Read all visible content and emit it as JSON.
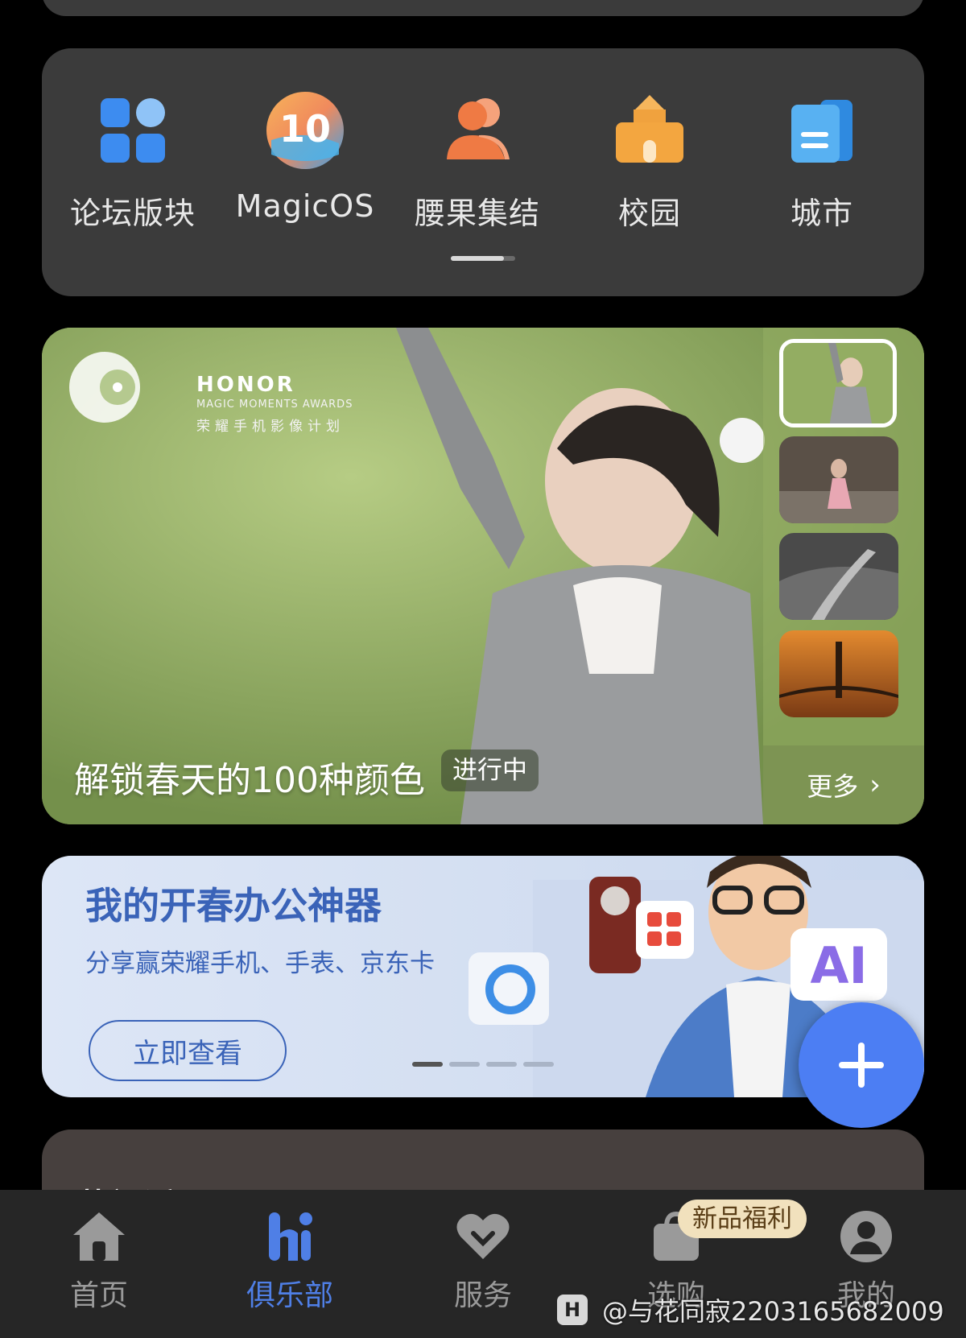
{
  "quick_nav": {
    "items": [
      {
        "label": "论坛版块",
        "icon": "grid-blocks-icon"
      },
      {
        "label": "MagicOS",
        "icon": "magicos-10-icon"
      },
      {
        "label": "腰果集结",
        "icon": "users-group-icon"
      },
      {
        "label": "校园",
        "icon": "school-building-icon"
      },
      {
        "label": "城市",
        "icon": "city-document-icon"
      }
    ]
  },
  "hero": {
    "brand": "HONOR",
    "brand_sub": "MAGIC MOMENTS AWARDS",
    "brand_cn": "荣耀手机影像计划",
    "title": "解锁春天的100种颜色",
    "status": "进行中",
    "more_label": "更多"
  },
  "banner": {
    "title": "我的开春办公神器",
    "subtitle": "分享赢荣耀手机、手表、京东卡",
    "button": "立即查看",
    "active_page": 1,
    "page_count": 4
  },
  "hot_topics": {
    "title": "热门话题"
  },
  "tabbar": {
    "tabs": [
      {
        "label": "首页",
        "icon": "home-icon"
      },
      {
        "label": "俱乐部",
        "icon": "hi-club-icon"
      },
      {
        "label": "服务",
        "icon": "heart-service-icon"
      },
      {
        "label": "选购",
        "icon": "shopping-bag-icon"
      },
      {
        "label": "我的",
        "icon": "profile-icon"
      }
    ],
    "active_tab": "俱乐部",
    "promo_badge": "新品福利"
  },
  "watermark": "@与花同寂2203165682009",
  "colors": {
    "accent": "#4c7ef3",
    "banner_text": "#3a63b8",
    "card_bg": "#3b3b3b",
    "tabbar_bg": "#262626"
  }
}
